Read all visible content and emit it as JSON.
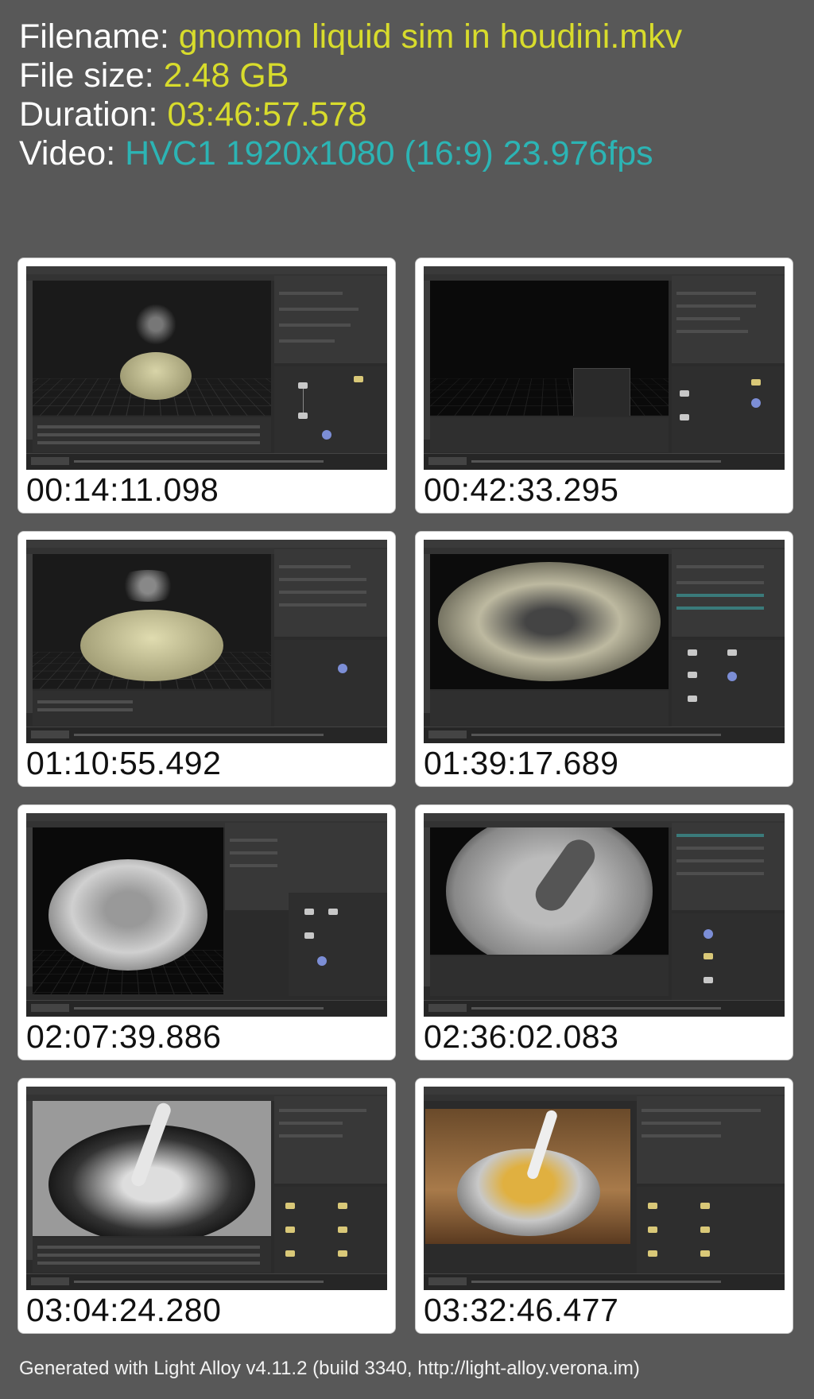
{
  "meta": {
    "filename_label": "Filename: ",
    "filename_value": "gnomon liquid sim in houdini.mkv",
    "filesize_label": "File size: ",
    "filesize_value": "2.48 GB",
    "duration_label": "Duration: ",
    "duration_value": "03:46:57.578",
    "video_label": "Video: ",
    "video_value": "HVC1 1920x1080 (16:9) 23.976fps"
  },
  "thumbnails": [
    {
      "timestamp": "00:14:11.098"
    },
    {
      "timestamp": "00:42:33.295"
    },
    {
      "timestamp": "01:10:55.492"
    },
    {
      "timestamp": "01:39:17.689"
    },
    {
      "timestamp": "02:07:39.886"
    },
    {
      "timestamp": "02:36:02.083"
    },
    {
      "timestamp": "03:04:24.280"
    },
    {
      "timestamp": "03:32:46.477"
    }
  ],
  "footer": "Generated with Light Alloy v4.11.2 (build 3340, http://light-alloy.verona.im)",
  "colors": {
    "background": "#585858",
    "value_yellow": "#d8dc2c",
    "value_teal": "#2cb4b4"
  }
}
